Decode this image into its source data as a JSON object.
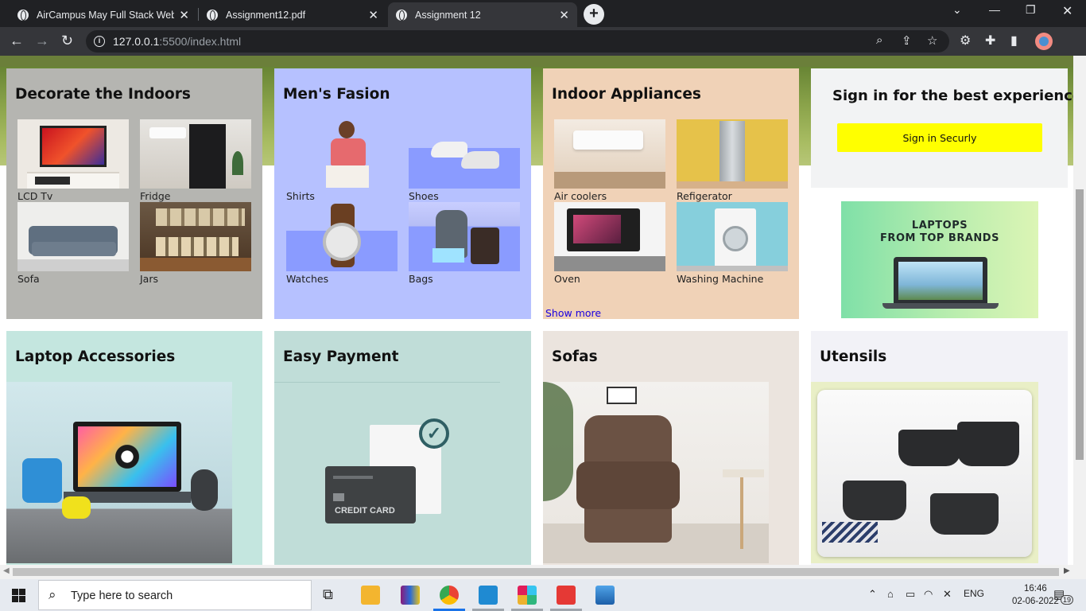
{
  "browser": {
    "tabs": [
      {
        "title": "AirCampus May Full Stack Web D",
        "active": false
      },
      {
        "title": "Assignment12.pdf",
        "active": false
      },
      {
        "title": "Assignment 12",
        "active": true
      }
    ],
    "url_host": "127.0.0.1",
    "url_rest": ":5500/index.html"
  },
  "cards": {
    "decorate": {
      "title": "Decorate the Indoors",
      "items": [
        "LCD Tv",
        "Fridge",
        "Sofa",
        "Jars"
      ],
      "bg": "#b5b5b1"
    },
    "fashion": {
      "title": "Men's Fasion",
      "items": [
        "Shirts",
        "Shoes",
        "Watches",
        "Bags"
      ],
      "bg": "#b6c1ff"
    },
    "appliances": {
      "title": "Indoor Appliances",
      "items": [
        "Air coolers",
        "Refigerator",
        "Oven",
        "Washing Machine"
      ],
      "show_more": "Show more",
      "bg": "#f0d2b7"
    },
    "signin": {
      "title": "Sign in for the best experience",
      "button": "Sign in Securly",
      "button_color": "#ffff00"
    },
    "ad": {
      "line1": "LAPTOPS",
      "line2": "FROM TOP BRANDS"
    },
    "laptop_acc": {
      "title": "Laptop Accessories",
      "bg": "#c4e6df"
    },
    "payment": {
      "title": "Easy Payment",
      "card_text": "CREDIT CARD",
      "bg": "#c0ddd8"
    },
    "sofas": {
      "title": "Sofas",
      "bg": "#ebe4de"
    },
    "utensils": {
      "title": "Utensils",
      "bg": "#f2f2f7"
    }
  },
  "taskbar": {
    "search_placeholder": "Type here to search",
    "lang": "ENG",
    "time": "16:46",
    "date": "02-06-2022",
    "notif_count": "19"
  }
}
